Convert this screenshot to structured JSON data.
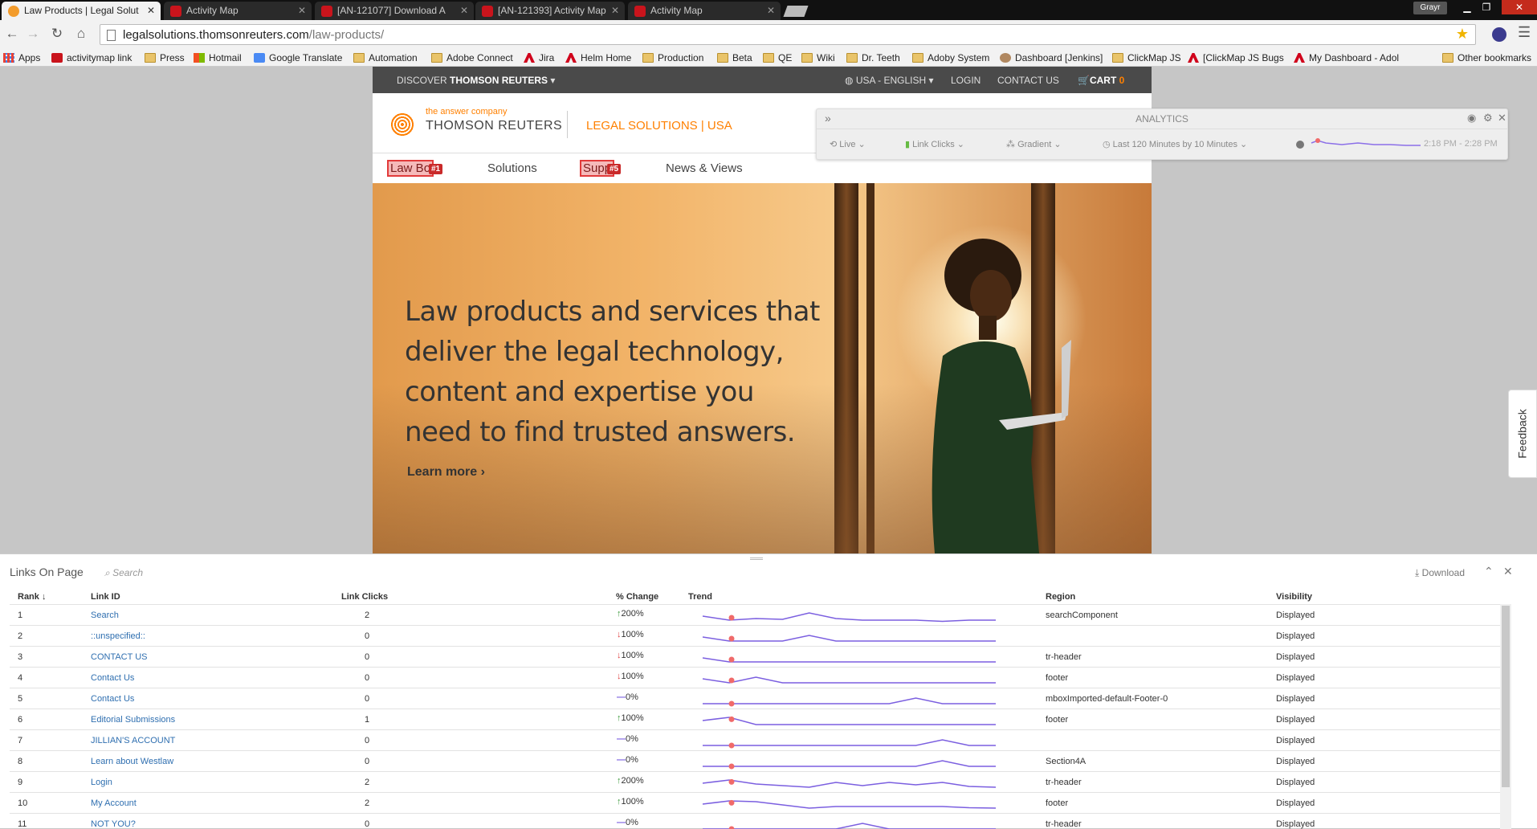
{
  "browser": {
    "tabs": [
      {
        "title": "Law Products | Legal Solut",
        "active": true
      },
      {
        "title": "Activity Map"
      },
      {
        "title": "[AN-121077] Download A"
      },
      {
        "title": "[AN-121393] Activity Map"
      },
      {
        "title": "Activity Map"
      }
    ],
    "profile": "Grayr",
    "url_host": "legalsolutions.thomsonreuters.com",
    "url_path": "/law-products/",
    "bookmarks": [
      "Apps",
      "activitymap link",
      "Press",
      "Hotmail",
      "Google Translate",
      "Automation",
      "Adobe Connect",
      "Jira",
      "Helm Home",
      "Production",
      "Beta",
      "QE",
      "Wiki",
      "Dr. Teeth",
      "Adoby System",
      "Dashboard [Jenkins]",
      "ClickMap JS",
      "[ClickMap JS Bugs",
      "My Dashboard - Adol",
      "Other bookmarks"
    ]
  },
  "site": {
    "topnav": {
      "discover_prefix": "DISCOVER",
      "discover_brand": "THOMSON REUTERS",
      "locale": "USA - ENGLISH",
      "login": "LOGIN",
      "contact": "CONTACT US",
      "cart": "CART",
      "cart_count": "0"
    },
    "tagline": "the answer company",
    "brand": "THOMSON REUTERS",
    "section": "LEGAL SOLUTIONS | USA",
    "secnav": {
      "law_books": "Law Bo",
      "law_books_badge": "#1",
      "solutions": "Solutions",
      "support": "Supp",
      "support_badge": "#5",
      "news": "News & Views"
    },
    "hero_heading": "Law products and services that deliver the legal technology, content and expertise you need to find trusted answers.",
    "hero_link": "Learn more"
  },
  "analytics": {
    "title": "ANALYTICS",
    "mode": "Live",
    "metric": "Link Clicks",
    "display": "Gradient",
    "range": "Last 120 Minutes by 10 Minutes",
    "time_span": "2:18 PM - 2:28 PM"
  },
  "feedback_label": "Feedback",
  "panel": {
    "title": "Links On Page",
    "search_placeholder": "Search",
    "download": "Download",
    "columns": {
      "rank": "Rank",
      "link_id": "Link ID",
      "clicks": "Link Clicks",
      "change": "% Change",
      "trend": "Trend",
      "region": "Region",
      "visibility": "Visibility"
    },
    "rows": [
      {
        "rank": "1",
        "link_id": "Search",
        "clicks": "2",
        "dir": "up",
        "change": "200%",
        "region": "searchComponent",
        "visibility": "Displayed",
        "trend": [
          1,
          0,
          0.4,
          0.2,
          1.8,
          0.4,
          0,
          0,
          0,
          -0.3,
          0,
          0
        ]
      },
      {
        "rank": "2",
        "link_id": "::unspecified::",
        "clicks": "0",
        "dir": "down",
        "change": "100%",
        "region": "",
        "visibility": "Displayed",
        "trend": [
          1,
          0,
          0,
          0,
          1.4,
          0,
          0,
          0,
          0,
          0,
          0,
          0
        ]
      },
      {
        "rank": "3",
        "link_id": "CONTACT US",
        "clicks": "0",
        "dir": "down",
        "change": "100%",
        "region": "tr-header",
        "visibility": "Displayed",
        "trend": [
          1,
          0,
          0,
          0,
          0,
          0,
          0,
          0,
          0,
          0,
          0,
          0
        ]
      },
      {
        "rank": "4",
        "link_id": "Contact Us",
        "clicks": "0",
        "dir": "down",
        "change": "100%",
        "region": "footer",
        "visibility": "Displayed",
        "trend": [
          1,
          0,
          1.4,
          0,
          0,
          0,
          0,
          0,
          0,
          0,
          0,
          0
        ]
      },
      {
        "rank": "5",
        "link_id": "Contact Us",
        "clicks": "0",
        "dir": "flat",
        "change": "0%",
        "region": "mboxImported-default-Footer-0",
        "visibility": "Displayed",
        "trend": [
          0,
          0,
          0,
          0,
          0,
          0,
          0,
          0,
          1.4,
          0,
          0,
          0
        ]
      },
      {
        "rank": "6",
        "link_id": "Editorial Submissions",
        "clicks": "1",
        "dir": "up",
        "change": "100%",
        "region": "footer",
        "visibility": "Displayed",
        "trend": [
          1,
          1.8,
          0,
          0,
          0,
          0,
          0,
          0,
          0,
          0,
          0,
          0
        ]
      },
      {
        "rank": "7",
        "link_id": "JILLIAN'S ACCOUNT",
        "clicks": "0",
        "dir": "flat",
        "change": "0%",
        "region": "",
        "visibility": "Displayed",
        "trend": [
          0,
          0,
          0,
          0,
          0,
          0,
          0,
          0,
          0,
          1.4,
          0,
          0
        ]
      },
      {
        "rank": "8",
        "link_id": "Learn about Westlaw",
        "clicks": "0",
        "dir": "flat",
        "change": "0%",
        "region": "Section4A",
        "visibility": "Displayed",
        "trend": [
          0,
          0,
          0,
          0,
          0,
          0,
          0,
          0,
          0,
          1.4,
          0,
          0
        ]
      },
      {
        "rank": "9",
        "link_id": "Login",
        "clicks": "2",
        "dir": "up",
        "change": "200%",
        "region": "tr-header",
        "visibility": "Displayed",
        "trend": [
          1,
          1.8,
          0.8,
          0.4,
          0,
          1.2,
          0.4,
          1.2,
          0.6,
          1.2,
          0.2,
          0
        ]
      },
      {
        "rank": "10",
        "link_id": "My Account",
        "clicks": "2",
        "dir": "up",
        "change": "100%",
        "region": "footer",
        "visibility": "Displayed",
        "trend": [
          1,
          1.8,
          1.6,
          0.8,
          0,
          0.4,
          0.4,
          0.4,
          0.4,
          0.4,
          0.1,
          0
        ]
      },
      {
        "rank": "11",
        "link_id": "NOT YOU?",
        "clicks": "0",
        "dir": "flat",
        "change": "0%",
        "region": "tr-header",
        "visibility": "Displayed",
        "trend": [
          0,
          0,
          0,
          0,
          0,
          0,
          1.4,
          0,
          0,
          0,
          0,
          0
        ]
      }
    ]
  }
}
